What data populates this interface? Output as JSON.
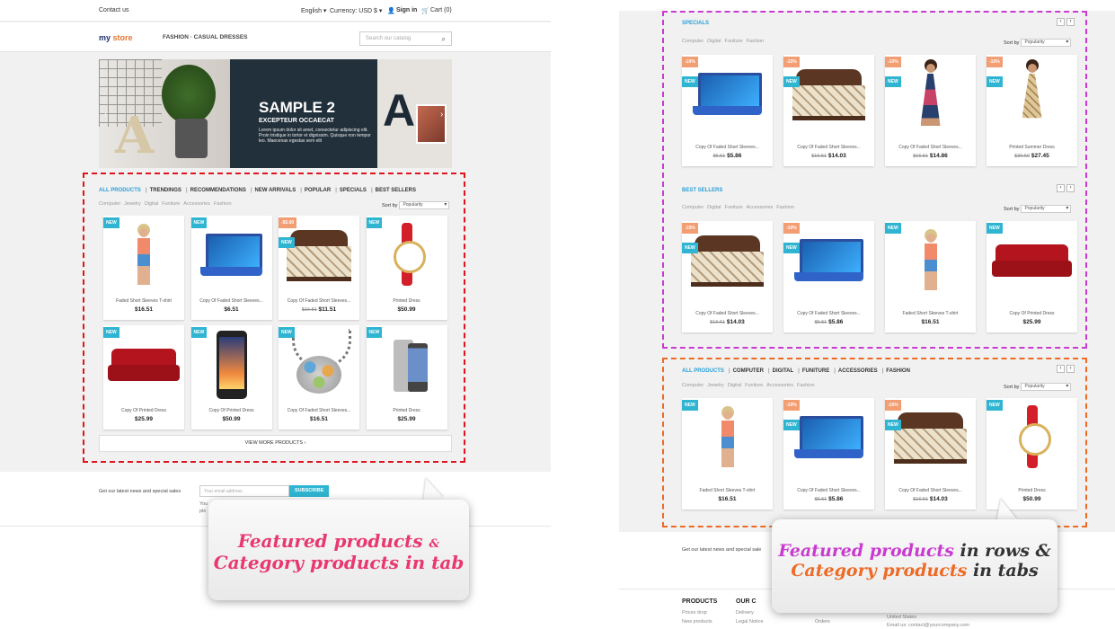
{
  "left": {
    "topbar": {
      "contact": "Contact us",
      "language": "English ▾",
      "currency": "Currency: USD $ ▾",
      "signin": "Sign in",
      "cart": "Cart (0)"
    },
    "header": {
      "logo_a": "my",
      "logo_b": "store",
      "nav": "FASHION · CASUAL DRESSES",
      "search_placeholder": "Search our catalog"
    },
    "banner": {
      "title": "SAMPLE 2",
      "subtitle": "EXCEPTEUR OCCAECAT",
      "text": "Lorem ipsum dolor sit amet, consectetur adipiscing elit. Proin tristique in tortor et dignissim. Quisque non tempor leo. Maecenas egestas sem elit",
      "prev": "‹",
      "next": "›"
    },
    "tabs": [
      "ALL PRODUCTS",
      "TRENDINGS",
      "RECOMMENDATIONS",
      "NEW ARRIVALS",
      "POPULAR",
      "SPECIALS",
      "BEST SELLERS"
    ],
    "subcats": [
      "Computer",
      "Jewelry",
      "Digital",
      "Funiture",
      "Accessories",
      "Fashion"
    ],
    "sort_label": "Sort by",
    "sort_value": "Popularity",
    "products": [
      {
        "name": "Faded Short Sleeves T-shirt",
        "price": "$16.51",
        "old": "",
        "badge": "NEW",
        "disc": "",
        "pic": "girl"
      },
      {
        "name": "Copy Of Faded Short Sleeves...",
        "price": "$6.51",
        "old": "",
        "badge": "NEW",
        "disc": "",
        "pic": "laptop"
      },
      {
        "name": "Copy Of Faded Short Sleeves...",
        "price": "$11.51",
        "old": "$16.51",
        "badge": "NEW",
        "disc": "-$5.00",
        "pic": "bed"
      },
      {
        "name": "Printed Dress",
        "price": "$50.99",
        "old": "",
        "badge": "NEW",
        "disc": "",
        "pic": "watch"
      },
      {
        "name": "Copy Of Printed Dress",
        "price": "$25.99",
        "old": "",
        "badge": "NEW",
        "disc": "",
        "pic": "sofa"
      },
      {
        "name": "Copy Of Printed Dress",
        "price": "$50.99",
        "old": "",
        "badge": "NEW",
        "disc": "",
        "pic": "phone"
      },
      {
        "name": "Copy Of Faded Short Sleeves...",
        "price": "$16.51",
        "old": "",
        "badge": "NEW",
        "disc": "",
        "pic": "neck"
      },
      {
        "name": "Printed Dress",
        "price": "$25.99",
        "old": "",
        "badge": "NEW",
        "disc": "",
        "pic": "htc"
      }
    ],
    "view_more": "VIEW MORE PRODUCTS  ›",
    "newsletter": {
      "label": "Get our latest news and special sales",
      "placeholder": "Your email address",
      "button": "SUBSCRIBE",
      "note1": "You",
      "note2": "ple"
    },
    "bubble": {
      "line1": "Featured products",
      "amp": "&",
      "line2": "Category products in tab"
    }
  },
  "right": {
    "specials": {
      "title": "SPECIALS",
      "subcats": [
        "Computer",
        "Digital",
        "Funiture",
        "Fashion"
      ],
      "sort_label": "Sort by",
      "sort_value": "Popularity",
      "products": [
        {
          "name": "Copy Of Faded Short Sleeves...",
          "old": "$6.51",
          "price": "$5.86",
          "disc": "-10%",
          "badge": "NEW",
          "pic": "laptop"
        },
        {
          "name": "Copy Of Faded Short Sleeves...",
          "old": "$16.51",
          "price": "$14.03",
          "disc": "-15%",
          "badge": "NEW",
          "pic": "bed"
        },
        {
          "name": "Copy Of Faded Short Sleeves...",
          "old": "$16.51",
          "price": "$14.86",
          "disc": "-10%",
          "badge": "NEW",
          "pic": "dress"
        },
        {
          "name": "Printed Summer Dress",
          "old": "$30.50",
          "price": "$27.45",
          "disc": "-10%",
          "badge": "NEW",
          "pic": "summer"
        }
      ]
    },
    "bestsellers": {
      "title": "BEST SELLERS",
      "subcats": [
        "Computer",
        "Digital",
        "Funiture",
        "Accessories",
        "Fashion"
      ],
      "sort_label": "Sort by",
      "sort_value": "Popularity",
      "products": [
        {
          "name": "Copy Of Faded Short Sleeves...",
          "old": "$16.51",
          "price": "$14.03",
          "disc": "-15%",
          "badge": "NEW",
          "pic": "bed"
        },
        {
          "name": "Copy Of Faded Short Sleeves...",
          "old": "$6.51",
          "price": "$5.86",
          "disc": "-10%",
          "badge": "NEW",
          "pic": "laptop"
        },
        {
          "name": "Faded Short Sleeves T-shirt",
          "old": "",
          "price": "$16.51",
          "disc": "",
          "badge": "NEW",
          "pic": "girl"
        },
        {
          "name": "Copy Of Printed Dress",
          "old": "",
          "price": "$25.99",
          "disc": "",
          "badge": "NEW",
          "pic": "sofa"
        }
      ]
    },
    "cattabs": {
      "tabs": [
        "ALL PRODUCTS",
        "COMPUTER",
        "DIGITAL",
        "FUNITURE",
        "ACCESSORIES",
        "FASHION"
      ],
      "subcats": [
        "Computer",
        "Jewelry",
        "Digital",
        "Funiture",
        "Accessories",
        "Fashion"
      ],
      "sort_label": "Sort by",
      "sort_value": "Popularity",
      "products": [
        {
          "name": "Faded Short Sleeves T-shirt",
          "old": "",
          "price": "$16.51",
          "disc": "",
          "badge": "NEW",
          "pic": "girl"
        },
        {
          "name": "Copy Of Faded Short Sleeves...",
          "old": "$6.51",
          "price": "$5.86",
          "disc": "-10%",
          "badge": "NEW",
          "pic": "laptop"
        },
        {
          "name": "Copy Of Faded Short Sleeves...",
          "old": "$16.51",
          "price": "$14.03",
          "disc": "-15%",
          "badge": "NEW",
          "pic": "bed"
        },
        {
          "name": "Printed Dress",
          "old": "",
          "price": "$50.99",
          "disc": "",
          "badge": "NEW",
          "pic": "watch"
        }
      ]
    },
    "newsletter": "Get our latest news and special sale",
    "footer": {
      "col1_title": "PRODUCTS",
      "col1_a": "Prices drop",
      "col1_b": "New products",
      "col2_title": "OUR C",
      "col2_a": "Delivery",
      "col2_b": "Legal Notice",
      "col3_b": "Orders",
      "col4_a": "United States",
      "col4_b": "Email us: contact@yourcompany.com"
    },
    "bubble": {
      "line1a": "Featured products",
      "line1b": " in rows &",
      "line2a": "Category products",
      "line2b": " in tabs"
    }
  },
  "colors": {
    "red_box": "#e0141e",
    "magenta_box": "#c93bd0",
    "orange_box": "#ee6a25",
    "accent": "#2fb5d2",
    "bubble_pink": "#e8386f",
    "bubble_magenta": "#c93bd0",
    "bubble_orange": "#ee6a25"
  }
}
